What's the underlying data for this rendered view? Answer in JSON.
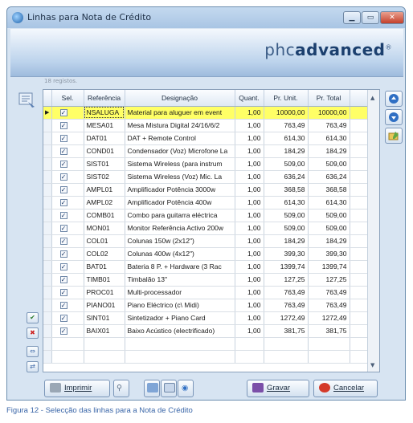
{
  "window": {
    "title": "Linhas para Nota de Crédito",
    "minimize_label": "▁",
    "maximize_label": "▭",
    "close_label": "✕"
  },
  "banner": {
    "logo_left": "phc",
    "logo_right": "advanced",
    "logo_mark": "®"
  },
  "grid": {
    "record_count": "18 registos.",
    "columns": [
      "Sel.",
      "Referência",
      "Designação",
      "Quant.",
      "Pr. Unit.",
      "Pr. Total"
    ],
    "rows": [
      {
        "ref": "NSALUGA",
        "desc": "Material para aluguer em event",
        "qty": "1,00",
        "unit": "10000,00",
        "total": "10000,00"
      },
      {
        "ref": "MESA01",
        "desc": "Mesa Mistura Digital 24/16/6/2",
        "qty": "1,00",
        "unit": "763,49",
        "total": "763,49"
      },
      {
        "ref": "DAT01",
        "desc": "DAT + Remote Control",
        "qty": "1,00",
        "unit": "614,30",
        "total": "614,30"
      },
      {
        "ref": "COND01",
        "desc": "Condensador (Voz) Microfone La",
        "qty": "1,00",
        "unit": "184,29",
        "total": "184,29"
      },
      {
        "ref": "SIST01",
        "desc": "Sistema Wireless (para instrum",
        "qty": "1,00",
        "unit": "509,00",
        "total": "509,00"
      },
      {
        "ref": "SIST02",
        "desc": "Sistema Wireless (Voz) Mic. La",
        "qty": "1,00",
        "unit": "636,24",
        "total": "636,24"
      },
      {
        "ref": "AMPL01",
        "desc": "Amplificador Potência 3000w",
        "qty": "1,00",
        "unit": "368,58",
        "total": "368,58"
      },
      {
        "ref": "AMPL02",
        "desc": "Amplificador Potência 400w",
        "qty": "1,00",
        "unit": "614,30",
        "total": "614,30"
      },
      {
        "ref": "COMB01",
        "desc": "Combo para guitarra eléctrica",
        "qty": "1,00",
        "unit": "509,00",
        "total": "509,00"
      },
      {
        "ref": "MON01",
        "desc": "Monitor Referência Activo 200w",
        "qty": "1,00",
        "unit": "509,00",
        "total": "509,00"
      },
      {
        "ref": "COL01",
        "desc": "Colunas 150w (2x12\")",
        "qty": "1,00",
        "unit": "184,29",
        "total": "184,29"
      },
      {
        "ref": "COL02",
        "desc": "Colunas 400w (4x12\")",
        "qty": "1,00",
        "unit": "399,30",
        "total": "399,30"
      },
      {
        "ref": "BAT01",
        "desc": "Bateria 8 P. + Hardware (3 Rac",
        "qty": "1,00",
        "unit": "1399,74",
        "total": "1399,74"
      },
      {
        "ref": "TIMB01",
        "desc": "Timbalão 13\"",
        "qty": "1,00",
        "unit": "127,25",
        "total": "127,25"
      },
      {
        "ref": "PROC01",
        "desc": "Multi-processador",
        "qty": "1,00",
        "unit": "763,49",
        "total": "763,49"
      },
      {
        "ref": "PIANO01",
        "desc": "Piano Eléctrico (c\\ Midi)",
        "qty": "1,00",
        "unit": "763,49",
        "total": "763,49"
      },
      {
        "ref": "SINT01",
        "desc": "Sintetizador + Piano Card",
        "qty": "1,00",
        "unit": "1272,49",
        "total": "1272,49"
      },
      {
        "ref": "BAIX01",
        "desc": "Baixo Acústico (electrificado)",
        "qty": "1,00",
        "unit": "381,75",
        "total": "381,75"
      }
    ]
  },
  "buttons": {
    "print": "Imprimir",
    "save": "Gravar",
    "cancel": "Cancelar"
  },
  "caption": "Figura 12 - Selecção das linhas para a Nota de Crédito"
}
